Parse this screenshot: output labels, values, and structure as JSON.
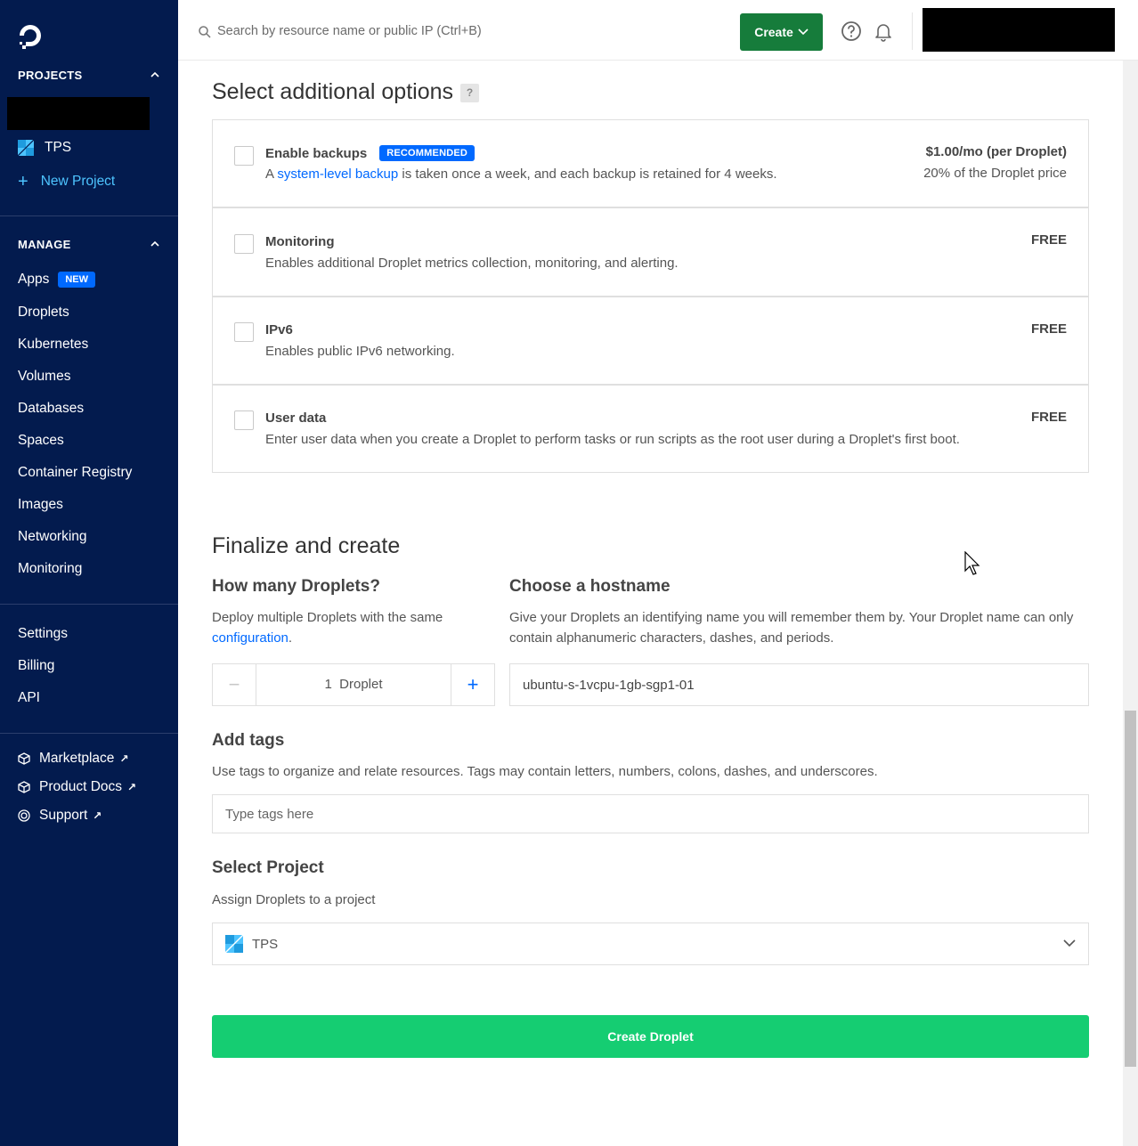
{
  "sidebar": {
    "projects_heading": "PROJECTS",
    "project_name": "TPS",
    "new_project_label": "New Project",
    "manage_heading": "MANAGE",
    "manage_items": [
      {
        "label": "Apps",
        "badge": "NEW"
      },
      {
        "label": "Droplets"
      },
      {
        "label": "Kubernetes"
      },
      {
        "label": "Volumes"
      },
      {
        "label": "Databases"
      },
      {
        "label": "Spaces"
      },
      {
        "label": "Container Registry"
      },
      {
        "label": "Images"
      },
      {
        "label": "Networking"
      },
      {
        "label": "Monitoring"
      }
    ],
    "account_items": [
      {
        "label": "Settings"
      },
      {
        "label": "Billing"
      },
      {
        "label": "API"
      }
    ],
    "external_links": [
      {
        "label": "Marketplace",
        "icon": "cube-icon"
      },
      {
        "label": "Product Docs",
        "icon": "cube-icon"
      },
      {
        "label": "Support",
        "icon": "lifebuoy-icon"
      }
    ],
    "colors": {
      "background": "#031b4e",
      "accent": "#4dc4ff"
    }
  },
  "topbar": {
    "search_placeholder": "Search by resource name or public IP (Ctrl+B)",
    "create_label": "Create",
    "create_color": "#167c3b"
  },
  "options": {
    "title": "Select additional options",
    "help_mark": "?",
    "items": [
      {
        "title": "Enable backups",
        "badge": "RECOMMENDED",
        "desc_prefix": "A ",
        "desc_link": "system-level backup",
        "desc_suffix": " is taken once a week, and each backup is retained for 4 weeks.",
        "price": "$1.00/mo (per Droplet)",
        "price_sub": "20% of the Droplet price",
        "checked": false
      },
      {
        "title": "Monitoring",
        "desc": "Enables additional Droplet metrics collection, monitoring, and alerting.",
        "price": "FREE",
        "checked": false
      },
      {
        "title": "IPv6",
        "desc": "Enables public IPv6 networking.",
        "price": "FREE",
        "checked": false
      },
      {
        "title": "User data",
        "desc": "Enter user data when you create a Droplet to perform tasks or run scripts as the root user during a Droplet's first boot.",
        "price": "FREE",
        "checked": false
      }
    ]
  },
  "finalize": {
    "title": "Finalize and create",
    "count": {
      "heading": "How many Droplets?",
      "desc_prefix": "Deploy multiple Droplets with the same",
      "desc_link": "configuration",
      "desc_suffix": ".",
      "minus": "−",
      "plus": "+",
      "value": "1  Droplet"
    },
    "hostname": {
      "heading": "Choose a hostname",
      "desc": "Give your Droplets an identifying name you will remember them by. Your Droplet name can only contain alphanumeric characters, dashes, and periods.",
      "value": "ubuntu-s-1vcpu-1gb-sgp1-01"
    },
    "tags": {
      "heading": "Add tags",
      "desc": "Use tags to organize and relate resources. Tags may contain letters, numbers, colons, dashes, and underscores.",
      "placeholder": "Type tags here"
    },
    "project": {
      "heading": "Select Project",
      "desc": "Assign Droplets to a project",
      "selected": "TPS"
    },
    "submit_label": "Create Droplet",
    "submit_color": "#15cd72"
  }
}
